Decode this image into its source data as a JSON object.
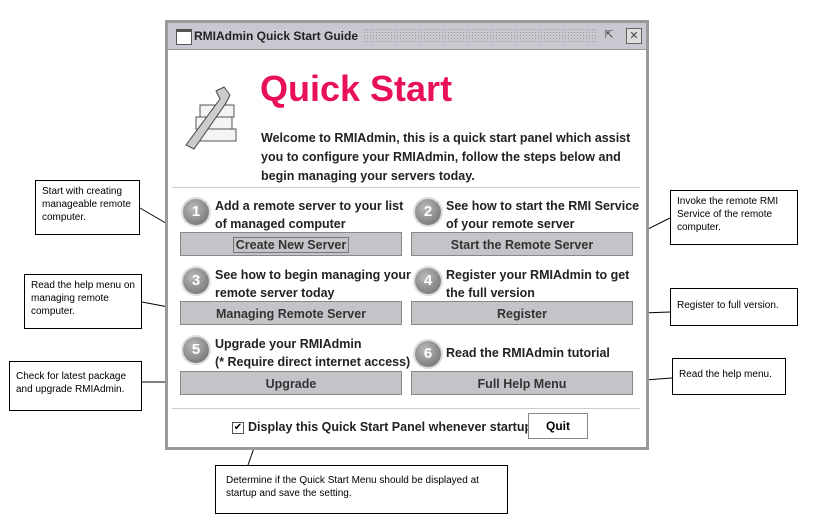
{
  "window": {
    "title": "RMIAdmin Quick Start Guide",
    "icon": "window-icon",
    "controls": [
      "restore-icon",
      "close-icon"
    ]
  },
  "header": {
    "title": "Quick Start",
    "title_color": "#e8105a",
    "welcome": "Welcome to RMIAdmin, this is a quick start panel which assist you to configure your RMIAdmin, follow the steps below and begin managing your servers today.",
    "logo": "wrench-books-icon"
  },
  "steps": [
    {
      "number": "1",
      "description": "Add a remote server to your list of managed computer",
      "button": "Create New Server"
    },
    {
      "number": "2",
      "description": "See how to start the RMI Service of your remote server",
      "button": "Start the Remote Server"
    },
    {
      "number": "3",
      "description": "See how to begin managing your remote server today",
      "button": "Managing Remote Server"
    },
    {
      "number": "4",
      "description": "Register your RMIAdmin to get the full version",
      "button": "Register"
    },
    {
      "number": "5",
      "description": "Upgrade your RMIAdmin",
      "description2": "(* Require direct internet access)",
      "button": "Upgrade"
    },
    {
      "number": "6",
      "description": "Read the RMIAdmin tutorial",
      "button": "Full Help Menu"
    }
  ],
  "footer": {
    "checkbox_label": "Display this Quick Start Panel whenever startup",
    "checked": true,
    "quit": "Quit"
  },
  "callouts": [
    "Start with  creating manageable remote computer.",
    "Invoke the remote RMI Service of the remote computer.",
    "Read the help menu on managing remote computer.",
    "Register to full version.",
    "Check for latest package and upgrade RMIAdmin.",
    "Read the help menu.",
    "Determine if the Quick Start Menu should be displayed at startup and save the setting."
  ]
}
